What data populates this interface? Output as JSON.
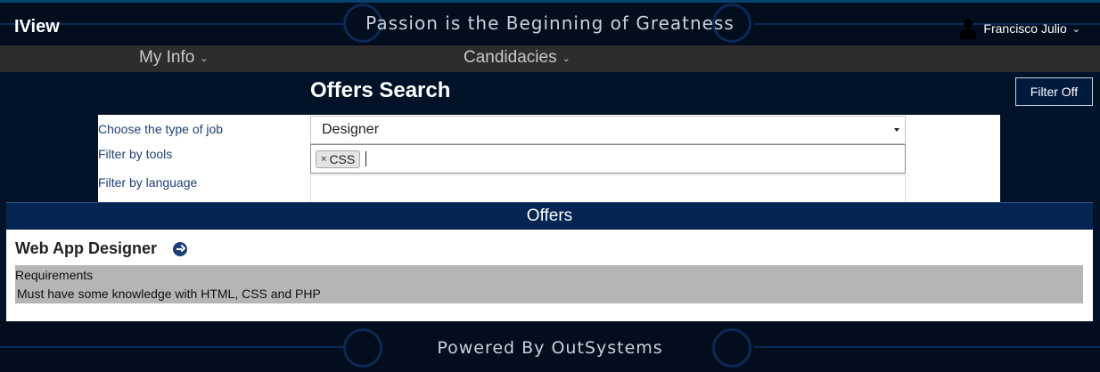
{
  "header": {
    "logo": "IView",
    "tagline": "Passion is the Beginning of Greatness",
    "user_name": "Francisco Julio"
  },
  "nav": {
    "items": [
      {
        "label": "My Info"
      },
      {
        "label": "Candidacies"
      }
    ]
  },
  "search": {
    "title": "Offers Search",
    "filter_button": "Filter Off",
    "job_type_label": "Choose the type of job",
    "job_type_value": "Designer",
    "tools_label": "Filter by tools",
    "tools_tags": [
      "CSS"
    ],
    "language_label": "Filter by language",
    "language_value": ""
  },
  "offers": {
    "header": "Offers",
    "items": [
      {
        "title": "Web App Designer",
        "requirements_label": "Requirements",
        "requirements_text": "Must have some knowledge with HTML, CSS and PHP"
      }
    ]
  },
  "footer": {
    "text": "Powered By OutSystems"
  },
  "colors": {
    "background": "#021228",
    "nav_bar": "#2d2d2d",
    "offers_bar": "#052553",
    "label_blue": "#1d3f73",
    "requirements_bg": "#b6b4b4"
  }
}
